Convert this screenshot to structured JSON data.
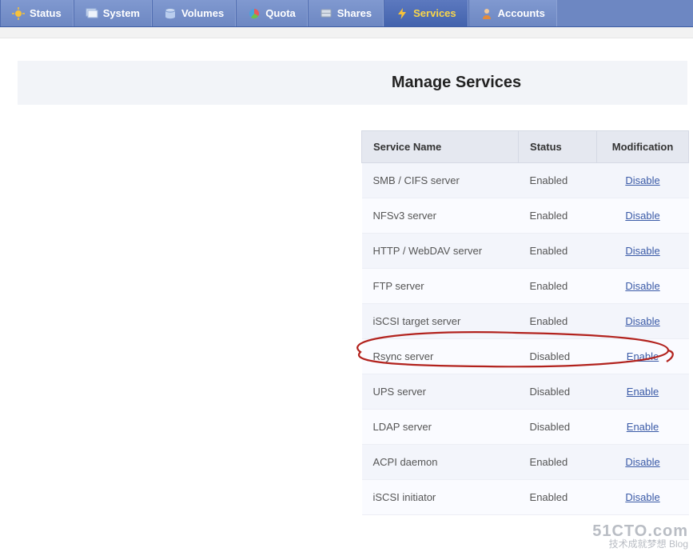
{
  "nav": {
    "items": [
      {
        "label": "Status",
        "icon": "status-icon"
      },
      {
        "label": "System",
        "icon": "system-icon"
      },
      {
        "label": "Volumes",
        "icon": "volumes-icon"
      },
      {
        "label": "Quota",
        "icon": "quota-icon"
      },
      {
        "label": "Shares",
        "icon": "shares-icon"
      },
      {
        "label": "Services",
        "icon": "services-icon",
        "active": true
      },
      {
        "label": "Accounts",
        "icon": "accounts-icon"
      }
    ]
  },
  "page": {
    "title": "Manage Services"
  },
  "table": {
    "headers": {
      "name": "Service Name",
      "status": "Status",
      "action": "Modification"
    },
    "rows": [
      {
        "name": "SMB / CIFS server",
        "status": "Enabled",
        "action": "Disable"
      },
      {
        "name": "NFSv3 server",
        "status": "Enabled",
        "action": "Disable"
      },
      {
        "name": "HTTP / WebDAV server",
        "status": "Enabled",
        "action": "Disable"
      },
      {
        "name": "FTP server",
        "status": "Enabled",
        "action": "Disable"
      },
      {
        "name": "iSCSI target server",
        "status": "Enabled",
        "action": "Disable"
      },
      {
        "name": "Rsync server",
        "status": "Disabled",
        "action": "Enable"
      },
      {
        "name": "UPS server",
        "status": "Disabled",
        "action": "Enable"
      },
      {
        "name": "LDAP server",
        "status": "Disabled",
        "action": "Enable"
      },
      {
        "name": "ACPI daemon",
        "status": "Enabled",
        "action": "Disable"
      },
      {
        "name": "iSCSI initiator",
        "status": "Enabled",
        "action": "Disable"
      }
    ]
  },
  "watermark": {
    "main": "51CTO.com",
    "sub": "技术成就梦想 Blog"
  }
}
